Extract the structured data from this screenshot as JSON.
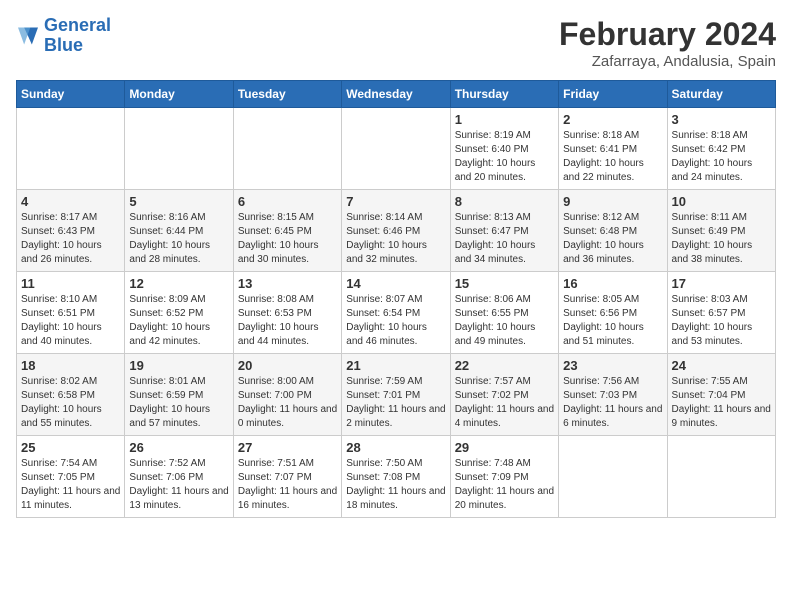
{
  "logo": {
    "line1": "General",
    "line2": "Blue"
  },
  "title": "February 2024",
  "subtitle": "Zafarraya, Andalusia, Spain",
  "headers": [
    "Sunday",
    "Monday",
    "Tuesday",
    "Wednesday",
    "Thursday",
    "Friday",
    "Saturday"
  ],
  "weeks": [
    [
      {
        "day": "",
        "detail": ""
      },
      {
        "day": "",
        "detail": ""
      },
      {
        "day": "",
        "detail": ""
      },
      {
        "day": "",
        "detail": ""
      },
      {
        "day": "1",
        "detail": "Sunrise: 8:19 AM\nSunset: 6:40 PM\nDaylight: 10 hours\nand 20 minutes."
      },
      {
        "day": "2",
        "detail": "Sunrise: 8:18 AM\nSunset: 6:41 PM\nDaylight: 10 hours\nand 22 minutes."
      },
      {
        "day": "3",
        "detail": "Sunrise: 8:18 AM\nSunset: 6:42 PM\nDaylight: 10 hours\nand 24 minutes."
      }
    ],
    [
      {
        "day": "4",
        "detail": "Sunrise: 8:17 AM\nSunset: 6:43 PM\nDaylight: 10 hours\nand 26 minutes."
      },
      {
        "day": "5",
        "detail": "Sunrise: 8:16 AM\nSunset: 6:44 PM\nDaylight: 10 hours\nand 28 minutes."
      },
      {
        "day": "6",
        "detail": "Sunrise: 8:15 AM\nSunset: 6:45 PM\nDaylight: 10 hours\nand 30 minutes."
      },
      {
        "day": "7",
        "detail": "Sunrise: 8:14 AM\nSunset: 6:46 PM\nDaylight: 10 hours\nand 32 minutes."
      },
      {
        "day": "8",
        "detail": "Sunrise: 8:13 AM\nSunset: 6:47 PM\nDaylight: 10 hours\nand 34 minutes."
      },
      {
        "day": "9",
        "detail": "Sunrise: 8:12 AM\nSunset: 6:48 PM\nDaylight: 10 hours\nand 36 minutes."
      },
      {
        "day": "10",
        "detail": "Sunrise: 8:11 AM\nSunset: 6:49 PM\nDaylight: 10 hours\nand 38 minutes."
      }
    ],
    [
      {
        "day": "11",
        "detail": "Sunrise: 8:10 AM\nSunset: 6:51 PM\nDaylight: 10 hours\nand 40 minutes."
      },
      {
        "day": "12",
        "detail": "Sunrise: 8:09 AM\nSunset: 6:52 PM\nDaylight: 10 hours\nand 42 minutes."
      },
      {
        "day": "13",
        "detail": "Sunrise: 8:08 AM\nSunset: 6:53 PM\nDaylight: 10 hours\nand 44 minutes."
      },
      {
        "day": "14",
        "detail": "Sunrise: 8:07 AM\nSunset: 6:54 PM\nDaylight: 10 hours\nand 46 minutes."
      },
      {
        "day": "15",
        "detail": "Sunrise: 8:06 AM\nSunset: 6:55 PM\nDaylight: 10 hours\nand 49 minutes."
      },
      {
        "day": "16",
        "detail": "Sunrise: 8:05 AM\nSunset: 6:56 PM\nDaylight: 10 hours\nand 51 minutes."
      },
      {
        "day": "17",
        "detail": "Sunrise: 8:03 AM\nSunset: 6:57 PM\nDaylight: 10 hours\nand 53 minutes."
      }
    ],
    [
      {
        "day": "18",
        "detail": "Sunrise: 8:02 AM\nSunset: 6:58 PM\nDaylight: 10 hours\nand 55 minutes."
      },
      {
        "day": "19",
        "detail": "Sunrise: 8:01 AM\nSunset: 6:59 PM\nDaylight: 10 hours\nand 57 minutes."
      },
      {
        "day": "20",
        "detail": "Sunrise: 8:00 AM\nSunset: 7:00 PM\nDaylight: 11 hours\nand 0 minutes."
      },
      {
        "day": "21",
        "detail": "Sunrise: 7:59 AM\nSunset: 7:01 PM\nDaylight: 11 hours\nand 2 minutes."
      },
      {
        "day": "22",
        "detail": "Sunrise: 7:57 AM\nSunset: 7:02 PM\nDaylight: 11 hours\nand 4 minutes."
      },
      {
        "day": "23",
        "detail": "Sunrise: 7:56 AM\nSunset: 7:03 PM\nDaylight: 11 hours\nand 6 minutes."
      },
      {
        "day": "24",
        "detail": "Sunrise: 7:55 AM\nSunset: 7:04 PM\nDaylight: 11 hours\nand 9 minutes."
      }
    ],
    [
      {
        "day": "25",
        "detail": "Sunrise: 7:54 AM\nSunset: 7:05 PM\nDaylight: 11 hours\nand 11 minutes."
      },
      {
        "day": "26",
        "detail": "Sunrise: 7:52 AM\nSunset: 7:06 PM\nDaylight: 11 hours\nand 13 minutes."
      },
      {
        "day": "27",
        "detail": "Sunrise: 7:51 AM\nSunset: 7:07 PM\nDaylight: 11 hours\nand 16 minutes."
      },
      {
        "day": "28",
        "detail": "Sunrise: 7:50 AM\nSunset: 7:08 PM\nDaylight: 11 hours\nand 18 minutes."
      },
      {
        "day": "29",
        "detail": "Sunrise: 7:48 AM\nSunset: 7:09 PM\nDaylight: 11 hours\nand 20 minutes."
      },
      {
        "day": "",
        "detail": ""
      },
      {
        "day": "",
        "detail": ""
      }
    ]
  ]
}
